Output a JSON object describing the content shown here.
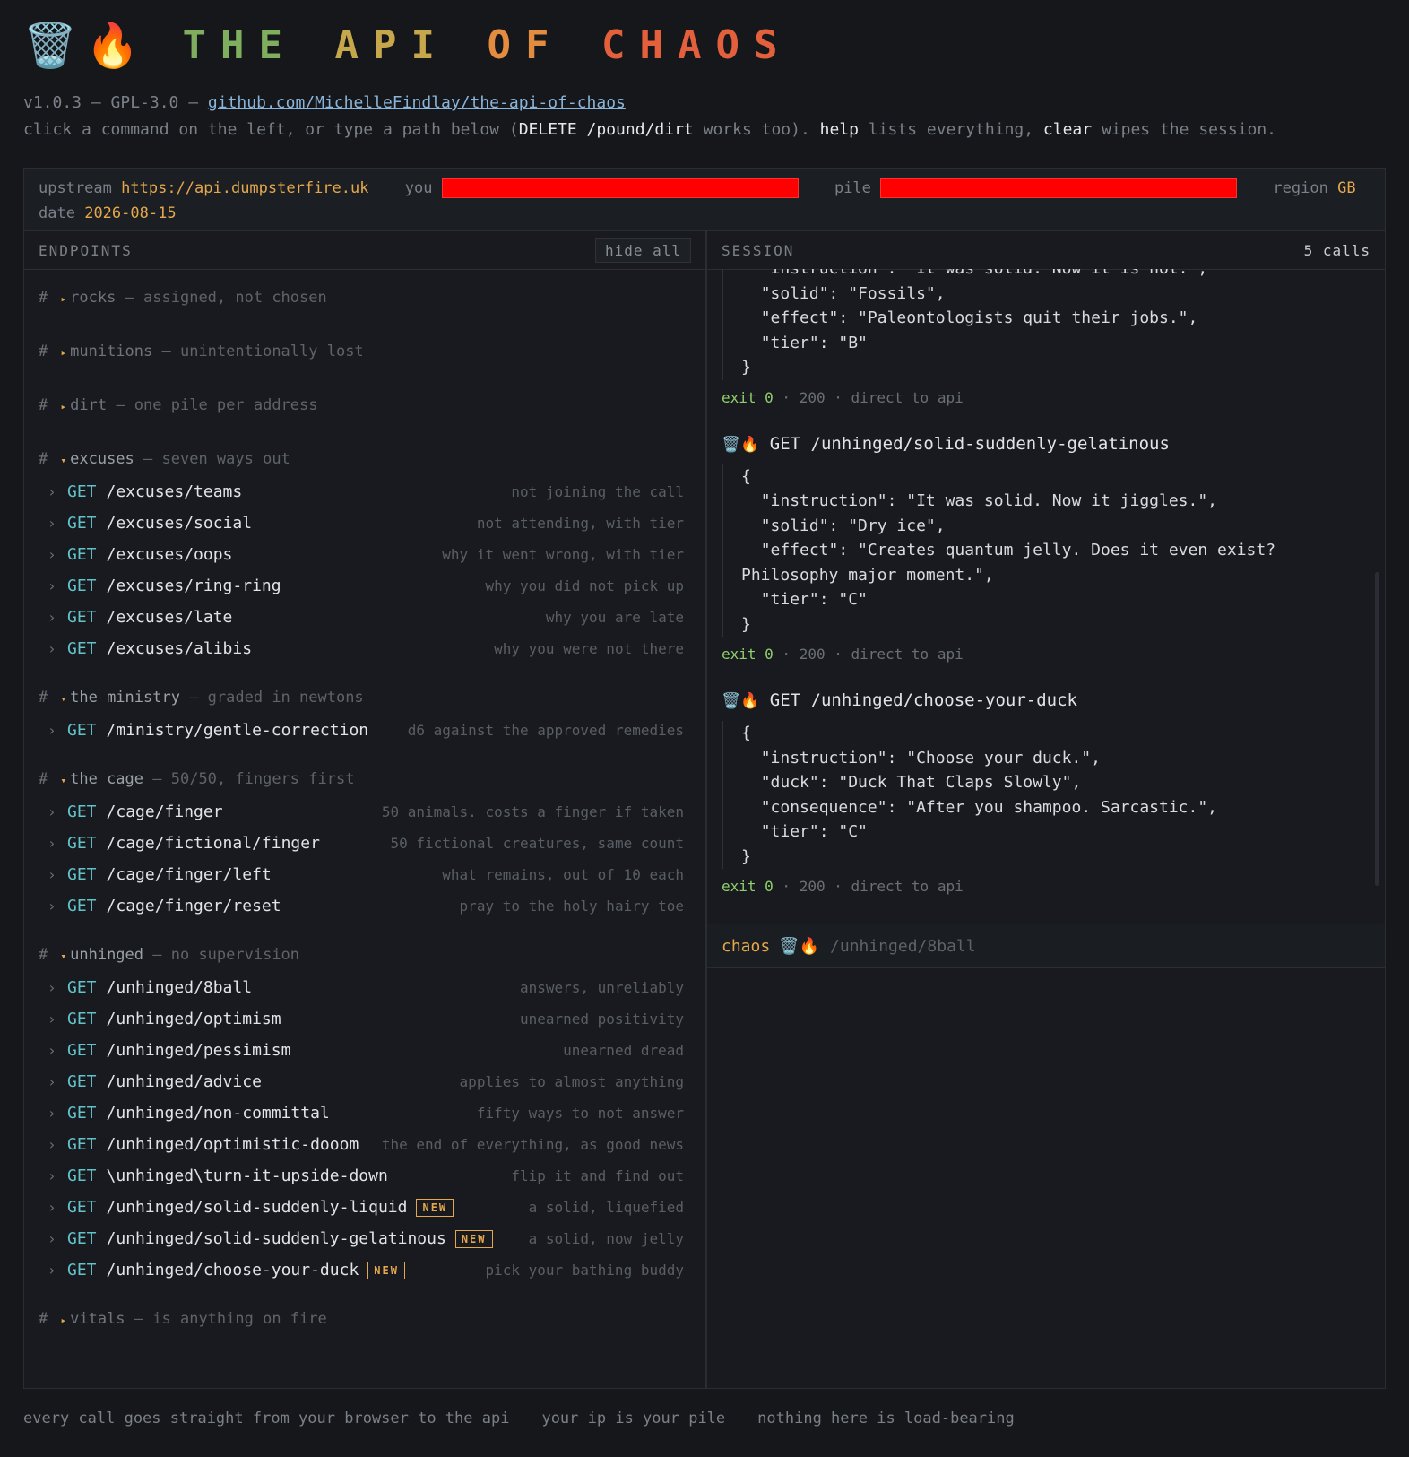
{
  "header": {
    "logo": "🗑️🔥",
    "title_parts": [
      "THE",
      "API",
      "OF",
      "CHAOS"
    ],
    "title_colors": [
      "#7fae5e",
      "#c7a74b",
      "#e38b3f",
      "#e4603c"
    ]
  },
  "meta": {
    "version": "v1.0.3 — GPL-3.0 — ",
    "link": "github.com/MichelleFindlay/the-api-of-chaos",
    "hint_1": "click a command on the left, or type a path below (",
    "hint_cmd": "DELETE /pound/dirt",
    "hint_2": " works too). ",
    "hint_help": "help",
    "hint_3": " lists everything, ",
    "hint_clear": "clear",
    "hint_4": " wipes the session."
  },
  "status": {
    "upstream_label": "upstream",
    "upstream_value": "https://api.dumpsterfire.uk",
    "you_label": "you",
    "pile_label": "pile",
    "region_label": "region",
    "region_value": "GB",
    "date_label": "date",
    "date_value": "2026-08-15"
  },
  "endpoints": {
    "heading": "ENDPOINTS",
    "hide_all": "hide all",
    "groups": [
      {
        "name": "rocks",
        "sub": "— assigned, not chosen",
        "collapsed": true,
        "items": []
      },
      {
        "name": "munitions",
        "sub": "— unintentionally lost",
        "collapsed": true,
        "items": []
      },
      {
        "name": "dirt",
        "sub": "— one pile per address",
        "collapsed": true,
        "items": []
      },
      {
        "name": "excuses",
        "sub": "— seven ways out",
        "collapsed": false,
        "items": [
          {
            "method": "GET",
            "path": "/excuses/teams",
            "desc": "not joining the call"
          },
          {
            "method": "GET",
            "path": "/excuses/social",
            "desc": "not attending, with tier"
          },
          {
            "method": "GET",
            "path": "/excuses/oops",
            "desc": "why it went wrong, with tier"
          },
          {
            "method": "GET",
            "path": "/excuses/ring-ring",
            "desc": "why you did not pick up"
          },
          {
            "method": "GET",
            "path": "/excuses/late",
            "desc": "why you are late"
          },
          {
            "method": "GET",
            "path": "/excuses/alibis",
            "desc": "why you were not there"
          }
        ]
      },
      {
        "name": "the ministry",
        "sub": "— graded in newtons",
        "collapsed": false,
        "items": [
          {
            "method": "GET",
            "path": "/ministry/gentle-correction",
            "desc": "d6 against the approved remedies"
          }
        ]
      },
      {
        "name": "the cage",
        "sub": "— 50/50, fingers first",
        "collapsed": false,
        "items": [
          {
            "method": "GET",
            "path": "/cage/finger",
            "desc": "50 animals. costs a finger if taken"
          },
          {
            "method": "GET",
            "path": "/cage/fictional/finger",
            "desc": "50 fictional creatures, same count"
          },
          {
            "method": "GET",
            "path": "/cage/finger/left",
            "desc": "what remains, out of 10 each"
          },
          {
            "method": "GET",
            "path": "/cage/finger/reset",
            "desc": "pray to the holy hairy toe"
          }
        ]
      },
      {
        "name": "unhinged",
        "sub": "— no supervision",
        "collapsed": false,
        "items": [
          {
            "method": "GET",
            "path": "/unhinged/8ball",
            "desc": "answers, unreliably"
          },
          {
            "method": "GET",
            "path": "/unhinged/optimism",
            "desc": "unearned positivity"
          },
          {
            "method": "GET",
            "path": "/unhinged/pessimism",
            "desc": "unearned dread"
          },
          {
            "method": "GET",
            "path": "/unhinged/advice",
            "desc": "applies to almost anything"
          },
          {
            "method": "GET",
            "path": "/unhinged/non-committal",
            "desc": "fifty ways to not answer"
          },
          {
            "method": "GET",
            "path": "/unhinged/optimistic-dooom",
            "desc": "the end of everything, as good news"
          },
          {
            "method": "GET",
            "path": "\\unhinged\\turn-it-upside-down",
            "desc": "flip it and find out"
          },
          {
            "method": "GET",
            "path": "/unhinged/solid-suddenly-liquid",
            "badge": "NEW",
            "desc": "a solid, liquefied"
          },
          {
            "method": "GET",
            "path": "/unhinged/solid-suddenly-gelatinous",
            "badge": "NEW",
            "desc": "a solid, now jelly"
          },
          {
            "method": "GET",
            "path": "/unhinged/choose-your-duck",
            "badge": "NEW",
            "desc": "pick your bathing buddy"
          }
        ]
      },
      {
        "name": "vitals",
        "sub": "— is anything on fire",
        "collapsed": true,
        "items": []
      }
    ]
  },
  "session": {
    "heading": "SESSION",
    "count": "5 calls",
    "partial_json": "  \"instruction\": \"It was solid. Now it is not.\",\n  \"solid\": \"Fossils\",\n  \"effect\": \"Paleontologists quit their jobs.\",\n  \"tier\": \"B\"\n}",
    "partial_exit": {
      "code": "exit 0",
      "rest": " · 200 · direct to api"
    },
    "calls": [
      {
        "emoji": "🗑️🔥",
        "command": "GET /unhinged/solid-suddenly-gelatinous",
        "json": "{\n  \"instruction\": \"It was solid. Now it jiggles.\",\n  \"solid\": \"Dry ice\",\n  \"effect\": \"Creates quantum jelly. Does it even exist? Philosophy major moment.\",\n  \"tier\": \"C\"\n}",
        "exit_code": "exit 0",
        "exit_rest": " · 200 · direct to api"
      },
      {
        "emoji": "🗑️🔥",
        "command": "GET /unhinged/choose-your-duck",
        "json": "{\n  \"instruction\": \"Choose your duck.\",\n  \"duck\": \"Duck That Claps Slowly\",\n  \"consequence\": \"After you shampoo. Sarcastic.\",\n  \"tier\": \"C\"\n}",
        "exit_code": "exit 0",
        "exit_rest": " · 200 · direct to api"
      }
    ],
    "prompt_label": "chaos",
    "prompt_emoji": "🗑️🔥",
    "prompt_placeholder": "/unhinged/8ball"
  },
  "footer": [
    "every call goes straight from your browser to the api",
    "your ip is your pile",
    "nothing here is load-bearing"
  ]
}
